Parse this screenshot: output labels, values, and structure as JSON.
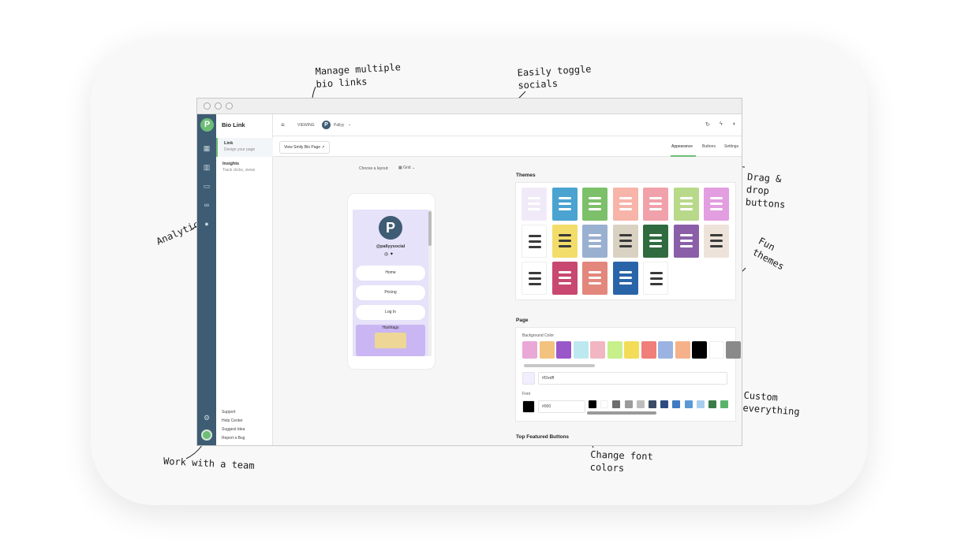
{
  "annotations": {
    "manage": "Manage multiple\nbio links",
    "toggle": "Easily toggle\nsocials",
    "drag": "Drag &\ndrop\nbuttons",
    "fun": "Fun\nthemes",
    "custom": "Custom\neverything",
    "font": "Change font\ncolors",
    "analytics": "Analytics",
    "team": "Work with a team"
  },
  "sidebar": {
    "title": "Bio Link",
    "items": [
      {
        "label": "Link",
        "sub": "Design your page"
      },
      {
        "label": "Insights",
        "sub": "Track clicks, views"
      }
    ],
    "footer": [
      "Support",
      "Help Center",
      "Suggest Idea",
      "Report a Bug"
    ]
  },
  "topbar": {
    "viewing": "VIEWING",
    "account": "Pallyy"
  },
  "subbar": {
    "view_link": "View Smily Bio Page",
    "tabs": [
      "Appearance",
      "Buttons",
      "Settings"
    ],
    "active_tab": "Appearance"
  },
  "layout": {
    "label": "Choose a layout:",
    "value": "Grid"
  },
  "phone": {
    "handle": "@pallyysocial",
    "buttons": [
      "Home",
      "Pricing",
      "Log In"
    ],
    "image_title": "Hashtags"
  },
  "themes": {
    "title": "Themes",
    "colors": [
      "#f0eaf8",
      "#4aa3d0",
      "#7cc06a",
      "#f7b4a8",
      "#f1a1aa",
      "#b8d98a",
      "#e29ee0",
      "#ffffff",
      "#f3dd6a",
      "#9ab0d0",
      "#d9d2c2",
      "#2f6b3e",
      "#8a5fa8",
      "#eee3da",
      "#ffffff",
      "#c84870",
      "#e3877c",
      "#2a64a8",
      "#ffffff"
    ]
  },
  "page": {
    "title": "Page",
    "bg_label": "Background Color",
    "bg_swatches": [
      "#e9a8d6",
      "#f2c27e",
      "#9a57c9",
      "#bde8ef",
      "#f1b6c1",
      "#c7ef8a",
      "#f3dc57",
      "#ef7f78",
      "#9bb3e2",
      "#f5b28a",
      "#000000",
      "#ffffff",
      "#8a8a8a"
    ],
    "bg_value": "#f2edff",
    "font_label": "Font",
    "font_value": "#000",
    "font_swatches": [
      "#000000",
      "#ffffff",
      "#6d6d6d",
      "#9b9b9b",
      "#bdbdbd",
      "#3b4c64",
      "#2d4a80",
      "#3f7bc1",
      "#5a99d6",
      "#a7cdef",
      "#3b7b47",
      "#5ab36b"
    ]
  },
  "top_featured": "Top Featured Buttons"
}
